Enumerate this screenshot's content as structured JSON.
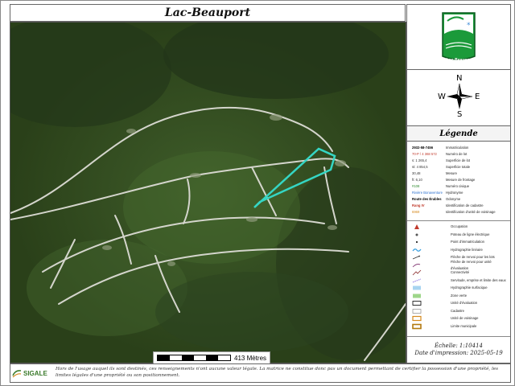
{
  "title": "Lac-Beauport",
  "logo": {
    "text": "Lac-Beauport",
    "icon": "municipal-crest-icon",
    "color": "#1b9a3a"
  },
  "compass": {
    "n": "N",
    "s": "S",
    "e": "E",
    "w": "W"
  },
  "legend": {
    "heading": "Légende",
    "text_items": [
      {
        "key": "2932-58-7456",
        "value": "Immatriculation",
        "color": "#000000",
        "bold": true
      },
      {
        "key": "70-P / 4 368 572",
        "value": "Numéro de lot",
        "color": "#c0392b",
        "bold": false
      },
      {
        "key": "s: 1 265,4",
        "value": "Superficie de lot",
        "color": "#333333",
        "bold": false
      },
      {
        "key": "st: 4 854,5",
        "value": "Superficie totale",
        "color": "#333333",
        "bold": false
      },
      {
        "key": "30,48",
        "value": "Mesure",
        "color": "#333333",
        "bold": false
      },
      {
        "key": "ft: 6,10",
        "value": "Mesure de frontage",
        "color": "#333333",
        "bold": false
      },
      {
        "key": "#108",
        "value": "Numéro civique",
        "color": "#2e8b2e",
        "bold": false
      },
      {
        "key": "Rivière Bonaventure",
        "value": "Hydronyme",
        "color": "#2a6fcf",
        "bold": false
      },
      {
        "key": "Route des Érables",
        "value": "Odonyme",
        "color": "#000000",
        "bold": true
      },
      {
        "key": "Rang IV",
        "value": "Identification de cadastre",
        "color": "#c0392b",
        "bold": true
      },
      {
        "key": "6969",
        "value": "Identification d'unité de voisinage",
        "color": "#d68a1e",
        "bold": false
      }
    ],
    "symbol_items": [
      {
        "icon": "occupation-triangle-icon",
        "label": "Occupation"
      },
      {
        "icon": "power-pole-icon",
        "label": "Poteau de ligne électrique"
      },
      {
        "icon": "registration-point-icon",
        "label": "Point d'immatriculation"
      },
      {
        "icon": "linear-hydrography-icon",
        "label": "Hydrographie linéaire"
      },
      {
        "icon": "lot-reference-arrow-icon",
        "label": "Flèche de renvoi pour les lots"
      },
      {
        "icon": "unit-reference-arrow-icon",
        "label": "Flèche de renvoi pour unité d'évaluation"
      },
      {
        "icon": "connectivity-icon",
        "label": "Connectivité"
      },
      {
        "icon": "servitude-icon",
        "label": "Servitude, emprise et limite des eaux"
      },
      {
        "icon": "surface-hydrography-icon",
        "label": "Hydrographie surfacique"
      },
      {
        "icon": "green-zone-icon",
        "label": "Zone verte"
      },
      {
        "icon": "evaluation-unit-icon",
        "label": "Unité d'évaluation"
      },
      {
        "icon": "cadastre-icon",
        "label": "Cadastre"
      },
      {
        "icon": "neighbourhood-unit-icon",
        "label": "Unité de voisinage"
      },
      {
        "icon": "municipal-limit-icon",
        "label": "Limite municipale"
      }
    ]
  },
  "scale_text": "Échelle: 1:10414",
  "print_date": "Date d'impression: 2025-05-19",
  "scalebar_label": "413 Mètres",
  "footer": {
    "brand": "SIGALE",
    "brand_icon": "sigale-logo-icon",
    "disclaimer": "Hors de l'usage auquel ils sont destinés, ces renseignements n'ont aucune valeur légale. La matrice ne constitue donc pas un document permettant de certifier la possession d'une propriété, les limites légales d'une propriété ou son positionnement."
  },
  "map": {
    "colors": {
      "forest_dark": "#1f3315",
      "forest": "#2f4a20",
      "forest_light": "#4b6b33",
      "road": "#cfd0c8",
      "parcel": "#35d6c4"
    }
  }
}
